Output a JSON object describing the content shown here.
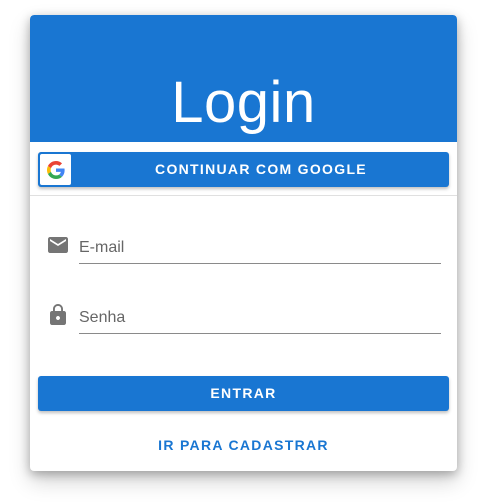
{
  "header": {
    "title": "Login"
  },
  "google_button": {
    "label": "CONTINUAR COM GOOGLE",
    "icon": "google-g-icon"
  },
  "form": {
    "email": {
      "placeholder": "E-mail",
      "value": "",
      "icon": "email-icon"
    },
    "password": {
      "placeholder": "Senha",
      "value": "",
      "icon": "lock-icon"
    }
  },
  "submit_button": {
    "label": "ENTRAR"
  },
  "register_link": {
    "label": "IR PARA CADASTRAR"
  },
  "colors": {
    "primary": "#1976d2",
    "icon_gray": "#757575"
  }
}
